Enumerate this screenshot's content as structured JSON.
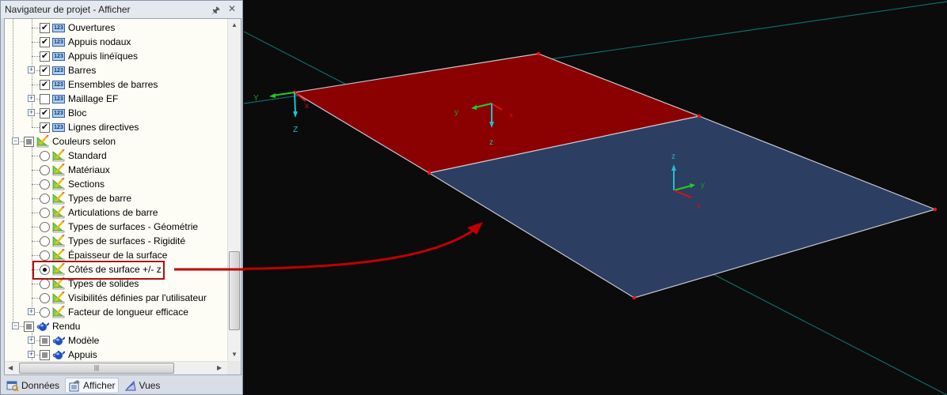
{
  "panel": {
    "title": "Navigateur de projet - Afficher",
    "pin_icon": "pin-icon",
    "close_icon": "close-icon"
  },
  "tree": {
    "items": [
      {
        "label": "Ouvertures",
        "type": "check",
        "checked": true,
        "icon": "numbering-icon",
        "level": 2,
        "expander": false
      },
      {
        "label": "Appuis nodaux",
        "type": "check",
        "checked": true,
        "icon": "numbering-icon",
        "level": 2,
        "expander": false
      },
      {
        "label": "Appuis linéïques",
        "type": "check",
        "checked": true,
        "icon": "numbering-icon",
        "level": 2,
        "expander": false
      },
      {
        "label": "Barres",
        "type": "check",
        "checked": true,
        "icon": "numbering-icon",
        "level": 2,
        "expander": "plus"
      },
      {
        "label": "Ensembles de barres",
        "type": "check",
        "checked": true,
        "icon": "numbering-icon",
        "level": 2,
        "expander": false
      },
      {
        "label": "Maillage EF",
        "type": "check",
        "checked": false,
        "icon": "numbering-icon",
        "level": 2,
        "expander": "plus"
      },
      {
        "label": "Bloc",
        "type": "check",
        "checked": true,
        "icon": "numbering-icon",
        "level": 2,
        "expander": "plus"
      },
      {
        "label": "Lignes directives",
        "type": "check",
        "checked": true,
        "icon": "numbering-icon",
        "level": 2,
        "expander": false
      },
      {
        "label": "Couleurs selon",
        "type": "partial",
        "icon": "color-ruler-icon",
        "level": 1,
        "expander": "minus"
      },
      {
        "label": "Standard",
        "type": "radio",
        "selected": false,
        "icon": "color-ruler-icon",
        "level": 2,
        "expander": false
      },
      {
        "label": "Matériaux",
        "type": "radio",
        "selected": false,
        "icon": "color-ruler-icon",
        "level": 2,
        "expander": false
      },
      {
        "label": "Sections",
        "type": "radio",
        "selected": false,
        "icon": "color-ruler-icon",
        "level": 2,
        "expander": false
      },
      {
        "label": "Types de barre",
        "type": "radio",
        "selected": false,
        "icon": "color-ruler-icon",
        "level": 2,
        "expander": false
      },
      {
        "label": "Articulations de barre",
        "type": "radio",
        "selected": false,
        "icon": "color-ruler-icon",
        "level": 2,
        "expander": false
      },
      {
        "label": "Types de surfaces - Géométrie",
        "type": "radio",
        "selected": false,
        "icon": "color-ruler-icon",
        "level": 2,
        "expander": false
      },
      {
        "label": "Types de surfaces - Rigidité",
        "type": "radio",
        "selected": false,
        "icon": "color-ruler-icon",
        "level": 2,
        "expander": false
      },
      {
        "label": "Épaisseur de la surface",
        "type": "radio",
        "selected": false,
        "icon": "color-ruler-icon",
        "level": 2,
        "expander": false
      },
      {
        "label": "Côtés de surface +/- z",
        "type": "radio",
        "selected": true,
        "icon": "color-ruler-icon",
        "level": 2,
        "expander": false
      },
      {
        "label": "Types de solides",
        "type": "radio",
        "selected": false,
        "icon": "color-ruler-icon",
        "level": 2,
        "expander": false
      },
      {
        "label": "Visibilités définies par l'utilisateur",
        "type": "radio",
        "selected": false,
        "icon": "color-ruler-icon",
        "level": 2,
        "expander": false
      },
      {
        "label": "Facteur de longueur efficace",
        "type": "radio",
        "selected": false,
        "icon": "color-ruler-icon",
        "level": 2,
        "expander": "plus"
      },
      {
        "label": "Rendu",
        "type": "partial",
        "icon": "teapot-icon",
        "level": 1,
        "expander": "minus"
      },
      {
        "label": "Modèle",
        "type": "partial",
        "icon": "teapot-icon",
        "level": 2,
        "expander": "plus"
      },
      {
        "label": "Appuis",
        "type": "partial",
        "icon": "teapot-icon",
        "level": 2,
        "expander": "plus"
      }
    ]
  },
  "tabs": [
    {
      "label": "Données",
      "icon": "data-icon",
      "active": false
    },
    {
      "label": "Afficher",
      "icon": "display-icon",
      "active": true
    },
    {
      "label": "Vues",
      "icon": "views-icon",
      "active": false
    }
  ],
  "viewport": {
    "global_axes": {
      "x": "x",
      "y": "Y",
      "z": "Z"
    },
    "surface_top": {
      "color": "#8b0000",
      "side": "+z / -z",
      "axes": {
        "x": "x",
        "y": "y",
        "z": "z"
      }
    },
    "surface_bottom": {
      "color": "#2c3e62",
      "axes": {
        "x": "x",
        "y": "y",
        "z": "z"
      }
    },
    "annotation_color": "#c00000"
  }
}
